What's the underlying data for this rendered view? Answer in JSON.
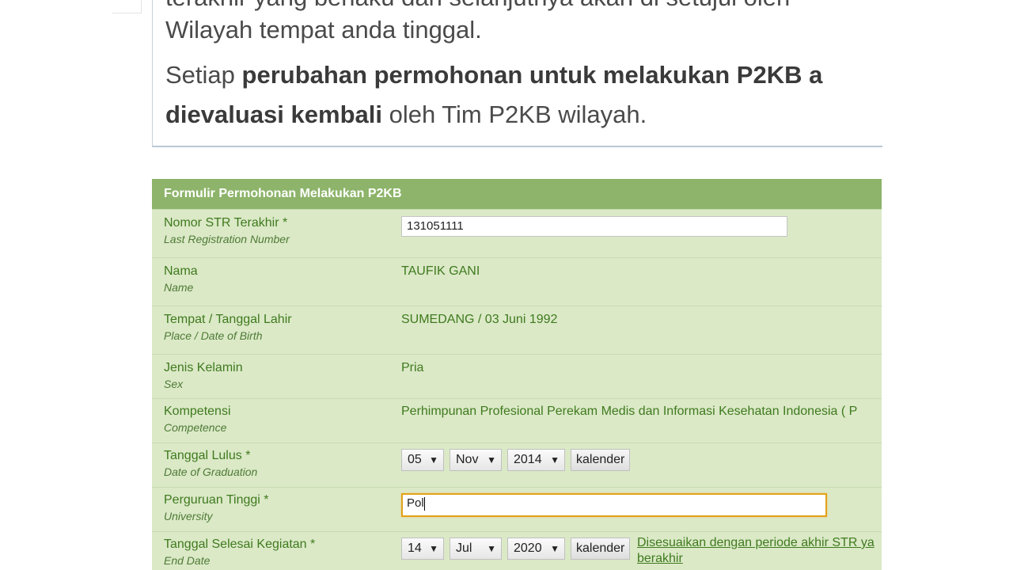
{
  "notice": {
    "line1": "terakhir yang berlaku dan selanjutnya akan di setujui oleh",
    "line2": "Wilayah tempat anda tinggal.",
    "line3_pre": "Setiap ",
    "line3_bold": "perubahan permohonan untuk melakukan P2KB a",
    "line4_bold": "dievaluasi kembali",
    "line4_post": " oleh Tim P2KB wilayah."
  },
  "form": {
    "title": "Formulir Permohonan Melakukan P2KB",
    "str": {
      "label": "Nomor STR Terakhir *",
      "label_en": "Last Registration Number",
      "value": "131051111"
    },
    "name": {
      "label": "Nama",
      "label_en": "Name",
      "value": "TAUFIK GANI"
    },
    "birth": {
      "label": "Tempat / Tanggal Lahir",
      "label_en": "Place / Date of Birth",
      "value": "SUMEDANG / 03 Juni 1992"
    },
    "sex": {
      "label": "Jenis Kelamin",
      "label_en": "Sex",
      "value": "Pria"
    },
    "competence": {
      "label": "Kompetensi",
      "label_en": "Competence",
      "value": "Perhimpunan Profesional Perekam Medis dan Informasi Kesehatan Indonesia ( P"
    },
    "graduation": {
      "label": "Tanggal Lulus *",
      "label_en": "Date of Graduation",
      "day": "05",
      "month": "Nov",
      "year": "2014",
      "calendar": "kalender"
    },
    "university": {
      "label": "Perguruan Tinggi *",
      "label_en": "University",
      "value": "Pol"
    },
    "end": {
      "label": "Tanggal Selesai Kegiatan *",
      "label_en": "End Date",
      "day": "14",
      "month": "Jul",
      "year": "2020",
      "calendar": "kalender",
      "hint_line1": "Disesuaikan dengan periode akhir STR ya",
      "hint_line2": "berakhir"
    }
  },
  "colors": {
    "header_bg": "#8db46a",
    "form_bg": "#dbe9c7",
    "label_text": "#3f7a1e",
    "focus_border": "#e3a21a"
  },
  "icons": {
    "dropdown": "triangle-down-icon"
  }
}
